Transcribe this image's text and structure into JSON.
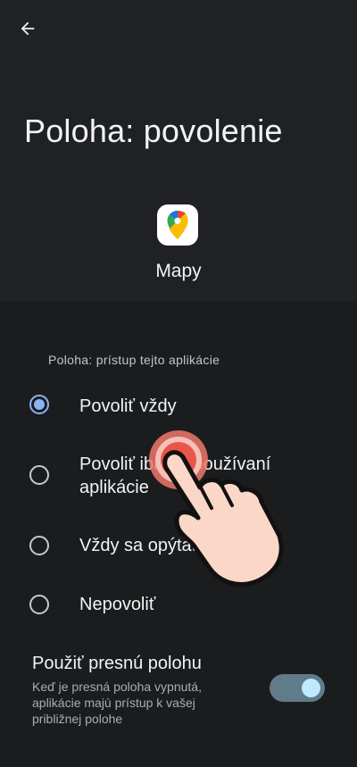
{
  "header": {
    "back_icon": "arrow-back-icon",
    "title": "Poloha: povolenie"
  },
  "app": {
    "icon": "google-maps-icon",
    "name": "Mapy"
  },
  "permission": {
    "section_label": "Poloha: prístup tejto aplikácie",
    "options": [
      {
        "label": "Povoliť vždy",
        "selected": true
      },
      {
        "label": "Povoliť iba pri používaní aplikácie",
        "selected": false
      },
      {
        "label": "Vždy sa opýtať",
        "selected": false
      },
      {
        "label": "Nepovoliť",
        "selected": false
      }
    ]
  },
  "precise": {
    "title": "Použiť presnú polohu",
    "description": "Keď je presná poloha vypnutá, aplikácie majú prístup k vašej približnej polohe",
    "enabled": true
  },
  "overlay": {
    "icon": "tap-hand-icon"
  },
  "colors": {
    "accent": "#8ab4f8",
    "toggle_track": "#607b8a",
    "toggle_knob": "#bfe9ff",
    "background": "#1b1c1e"
  }
}
